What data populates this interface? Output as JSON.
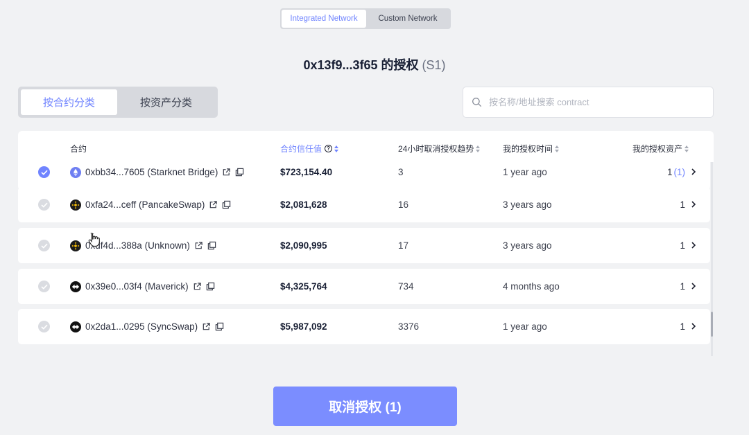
{
  "network_toggle": {
    "integrated": "Integrated Network",
    "custom": "Custom Network"
  },
  "title": {
    "main": "0x13f9...3f65 的授权",
    "sub": "(S1)"
  },
  "category_toggle": {
    "by_contract": "按合约分类",
    "by_asset": "按资产分类"
  },
  "search": {
    "placeholder": "按名称/地址搜索 contract"
  },
  "columns": {
    "contract": "合约",
    "trust": "合约信任值",
    "trend": "24小时取消授权趋势",
    "time": "我的授权时间",
    "assets": "我的授权资产"
  },
  "rows": [
    {
      "address": "0xbb34...7605 (Starknet Bridge)",
      "trust": "$723,154.40",
      "trend": "3",
      "time": "1 year ago",
      "assets": "1",
      "assets_selected": "(1)",
      "selected": true,
      "token_icon": "ethereum-icon"
    },
    {
      "address": "0xfa24...ceff (PancakeSwap)",
      "trust": "$2,081,628",
      "trend": "16",
      "time": "3 years ago",
      "assets": "1",
      "selected": false,
      "token_icon": "bnb-icon"
    },
    {
      "address": "0xdf4d...388a (Unknown)",
      "trust": "$2,090,995",
      "trend": "17",
      "time": "3 years ago",
      "assets": "1",
      "selected": false,
      "token_icon": "bnb-icon"
    },
    {
      "address": "0x39e0...03f4 (Maverick)",
      "trust": "$4,325,764",
      "trend": "734",
      "time": "4 months ago",
      "assets": "1",
      "selected": false,
      "token_icon": "zksync-icon"
    },
    {
      "address": "0x2da1...0295 (SyncSwap)",
      "trust": "$5,987,092",
      "trend": "3376",
      "time": "1 year ago",
      "assets": "1",
      "selected": false,
      "token_icon": "zksync-icon"
    }
  ],
  "revoke_button": "取消授权 (1)",
  "colors": {
    "accent": "#7084ff",
    "button": "#7b8dff",
    "background": "#f1f2f4"
  }
}
